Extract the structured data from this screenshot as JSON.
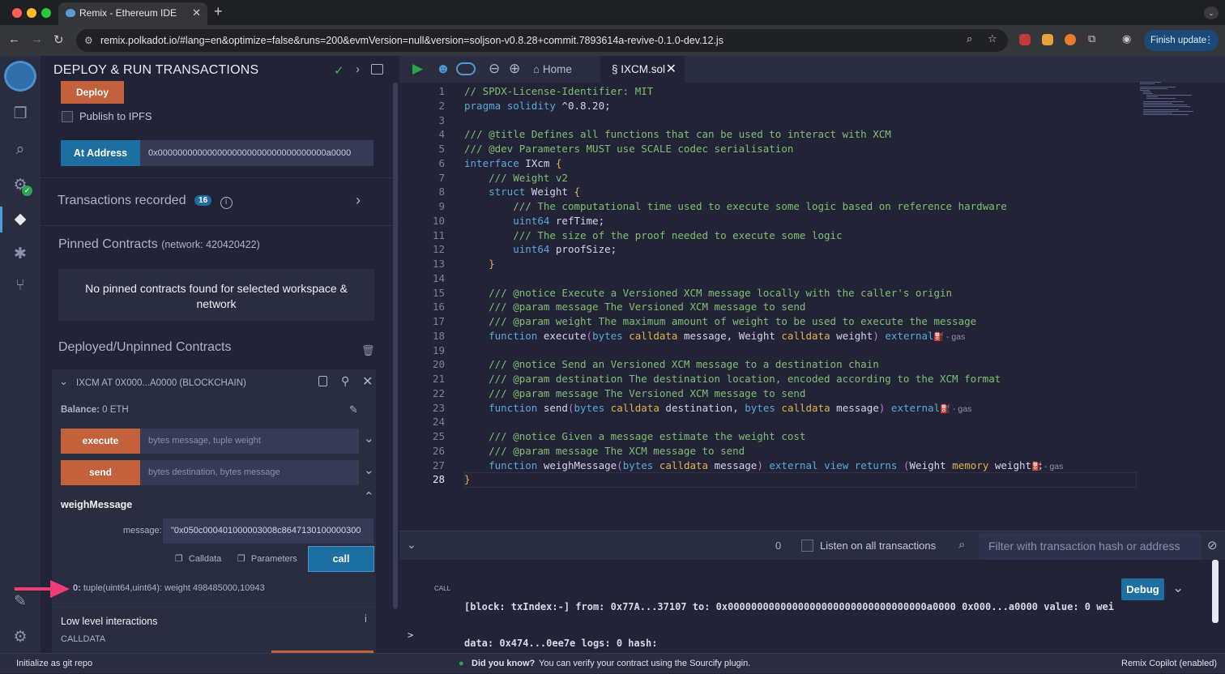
{
  "browser": {
    "tab_title": "Remix - Ethereum IDE",
    "new_tab_symbol": "+",
    "url": "remix.polkadot.io/#lang=en&optimize=false&runs=200&evmVersion=null&version=soljson-v0.8.28+commit.7893614a-revive-0.1.0-dev.12.js",
    "finish_update_label": "Finish update"
  },
  "panel": {
    "title": "DEPLOY & RUN TRANSACTIONS",
    "deploy_label": "Deploy",
    "publish_ipfs_label": "Publish to IPFS",
    "at_address_label": "At Address",
    "at_address_value": "0x0000000000000000000000000000000000a0000",
    "transactions_recorded_label": "Transactions recorded",
    "transactions_recorded_count": "16",
    "pinned_title": "Pinned Contracts",
    "pinned_network": "(network: 420420422)",
    "no_pinned_line1": "No pinned contracts found for selected workspace &",
    "no_pinned_line2": "network",
    "deployed_title": "Deployed/Unpinned Contracts",
    "contract_name": "IXCM AT 0X000...A0000 (BLOCKCHAIN)",
    "balance_label": "Balance:",
    "balance_value": "0 ETH",
    "functions": [
      {
        "name": "execute",
        "placeholder": "bytes message, tuple weight"
      },
      {
        "name": "send",
        "placeholder": "bytes destination, bytes message"
      }
    ],
    "weigh_title": "weighMessage",
    "message_label": "message:",
    "message_value": "\"0x050c000401000003008c8647130100000300",
    "calldata_label": "Calldata",
    "parameters_label": "Parameters",
    "call_label": "call",
    "result_index": "0:",
    "result_text": "tuple(uint64,uint64): weight 498485000,10943",
    "low_level_title": "Low level interactions",
    "calldata_heading": "CALLDATA"
  },
  "editor": {
    "home_tab": "Home",
    "file_tab": "IXCM.sol",
    "gas_label": "- gas",
    "lines": [
      "// SPDX-License-Identifier: MIT",
      "pragma solidity ^0.8.20;",
      "",
      "/// @title Defines all functions that can be used to interact with XCM",
      "/// @dev Parameters MUST use SCALE codec serialisation",
      "interface IXcm {",
      "    /// Weight v2",
      "    struct Weight {",
      "        /// The computational time used to execute some logic based on reference hardware",
      "        uint64 refTime;",
      "        /// The size of the proof needed to execute some logic",
      "        uint64 proofSize;",
      "    }",
      "",
      "    /// @notice Execute a Versioned XCM message locally with the caller's origin",
      "    /// @param message The Versioned XCM message to send",
      "    /// @param weight The maximum amount of weight to be used to execute the message",
      "    function execute(bytes calldata message, Weight calldata weight) external;",
      "",
      "    /// @notice Send an Versioned XCM message to a destination chain",
      "    /// @param destination The destination location, encoded according to the XCM format",
      "    /// @param message The Versioned XCM message to send",
      "    function send(bytes calldata destination, bytes calldata message) external;",
      "",
      "    /// @notice Given a message estimate the weight cost",
      "    /// @param message The XCM message to send",
      "    function weighMessage(bytes calldata message) external view returns (Weight memory weight);",
      "}"
    ]
  },
  "terminal": {
    "count": "0",
    "listen_label": "Listen on all transactions",
    "filter_placeholder": "Filter with transaction hash or address",
    "call_tag": "CALL",
    "log_line1": "[block: txIndex:-] from: 0x77A...37107 to: 0x0000000000000000000000000000000000a0000 0x000...a0000 value: 0 wei",
    "log_line2": "data: 0x474...0ee7e logs: 0 hash:",
    "debug_label": "Debug",
    "prompt": ">"
  },
  "statusbar": {
    "git_label": "Initialize as git repo",
    "did_you_know": "Did you know?",
    "tip": "You can verify your contract using the Sourcify plugin.",
    "copilot": "Remix Copilot (enabled)"
  },
  "colors": {
    "accent_blue": "#1e6fa1",
    "accent_orange": "#c2613b",
    "background": "#222336",
    "arrow_pink": "#ef3d78"
  }
}
